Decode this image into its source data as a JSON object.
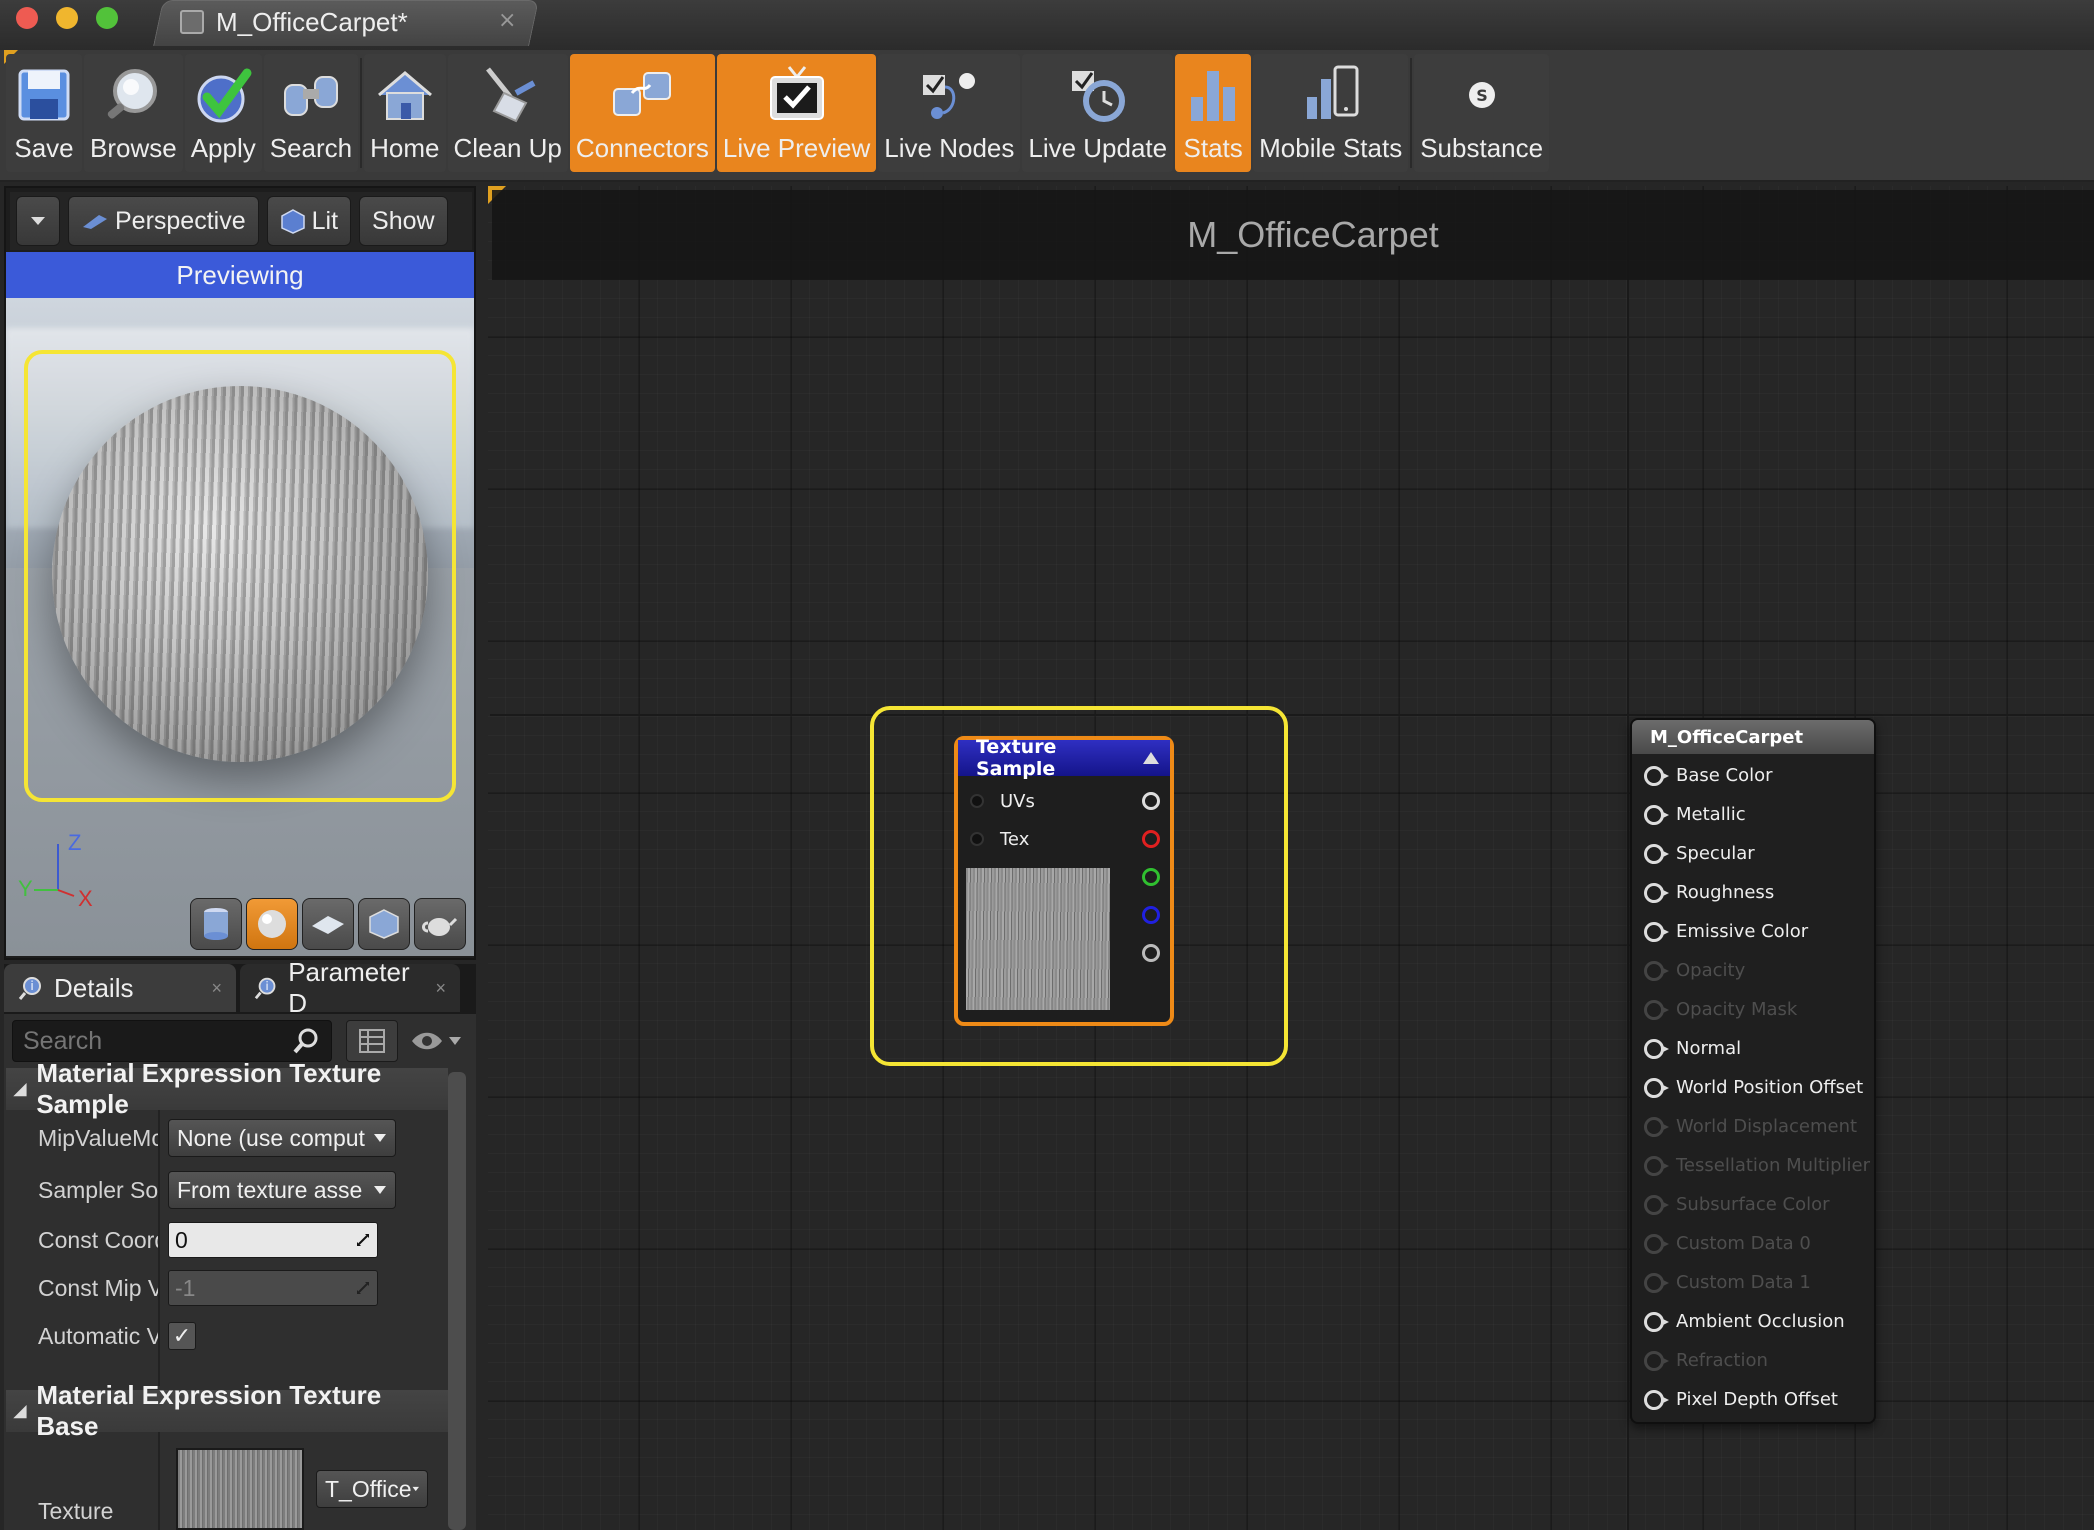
{
  "window": {
    "tab_title": "M_OfficeCarpet*",
    "tab_close": "×"
  },
  "toolbar": {
    "buttons": [
      {
        "label": "Save",
        "icon": "save-icon",
        "active": false
      },
      {
        "label": "Browse",
        "icon": "browse-icon",
        "active": false
      },
      {
        "label": "Apply",
        "icon": "apply-checkmark-icon",
        "active": false
      },
      {
        "label": "Search",
        "icon": "binoculars-icon",
        "active": false
      },
      {
        "label": "Home",
        "icon": "home-icon",
        "active": false
      },
      {
        "label": "Clean Up",
        "icon": "broom-icon",
        "active": false
      },
      {
        "label": "Connectors",
        "icon": "connectors-icon",
        "active": true
      },
      {
        "label": "Live Preview",
        "icon": "live-preview-icon",
        "active": true
      },
      {
        "label": "Live Nodes",
        "icon": "live-nodes-icon",
        "active": false
      },
      {
        "label": "Live Update",
        "icon": "live-update-icon",
        "active": false
      },
      {
        "label": "Stats",
        "icon": "stats-icon",
        "active": true
      },
      {
        "label": "Mobile Stats",
        "icon": "mobile-stats-icon",
        "active": false
      },
      {
        "label": "Substance",
        "icon": "substance-icon",
        "active": false
      }
    ],
    "active_color": "#e9851e"
  },
  "viewport": {
    "perspective_label": "Perspective",
    "lit_label": "Lit",
    "show_label": "Show",
    "previewing_label": "Previewing",
    "axis_z": "Z",
    "axis_y": "Y",
    "axis_x": "X",
    "preview_shapes": [
      "cylinder",
      "sphere",
      "plane",
      "cube",
      "teapot"
    ],
    "selected_shape": "sphere"
  },
  "details": {
    "tabs": [
      {
        "label": "Details",
        "close": "×"
      },
      {
        "label": "Parameter D",
        "close": "×"
      }
    ],
    "search_placeholder": "Search",
    "categories": {
      "sample": "Material Expression Texture Sample",
      "base": "Material Expression Texture Base"
    },
    "properties": [
      {
        "label": "MipValueMc",
        "type": "combo",
        "value": "None (use comput"
      },
      {
        "label": "Sampler Soı",
        "type": "combo",
        "value": "From texture asse"
      },
      {
        "label": "Const Coord",
        "type": "number",
        "value": "0"
      },
      {
        "label": "Const Mip V",
        "type": "number",
        "value": "-1",
        "disabled": true
      },
      {
        "label": "Automatic V",
        "type": "checkbox",
        "value": "✓"
      }
    ],
    "texture_label": "Texture",
    "texture_value": "T_Office"
  },
  "graph": {
    "title": "M_OfficeCarpet",
    "texture_node": {
      "title": "Texture Sample",
      "inputs": [
        "UVs",
        "Tex"
      ],
      "output_colors": [
        "#dddddd",
        "#e02020",
        "#30c030",
        "#2020e0",
        "#bbbbbb"
      ]
    },
    "result_node": {
      "title": "M_OfficeCarpet",
      "pins": [
        {
          "label": "Base Color",
          "enabled": true
        },
        {
          "label": "Metallic",
          "enabled": true
        },
        {
          "label": "Specular",
          "enabled": true
        },
        {
          "label": "Roughness",
          "enabled": true
        },
        {
          "label": "Emissive Color",
          "enabled": true
        },
        {
          "label": "Opacity",
          "enabled": false
        },
        {
          "label": "Opacity Mask",
          "enabled": false
        },
        {
          "label": "Normal",
          "enabled": true
        },
        {
          "label": "World Position Offset",
          "enabled": true
        },
        {
          "label": "World Displacement",
          "enabled": false
        },
        {
          "label": "Tessellation Multiplier",
          "enabled": false
        },
        {
          "label": "Subsurface Color",
          "enabled": false
        },
        {
          "label": "Custom Data 0",
          "enabled": false
        },
        {
          "label": "Custom Data 1",
          "enabled": false
        },
        {
          "label": "Ambient Occlusion",
          "enabled": true
        },
        {
          "label": "Refraction",
          "enabled": false
        },
        {
          "label": "Pixel Depth Offset",
          "enabled": true
        }
      ]
    }
  }
}
